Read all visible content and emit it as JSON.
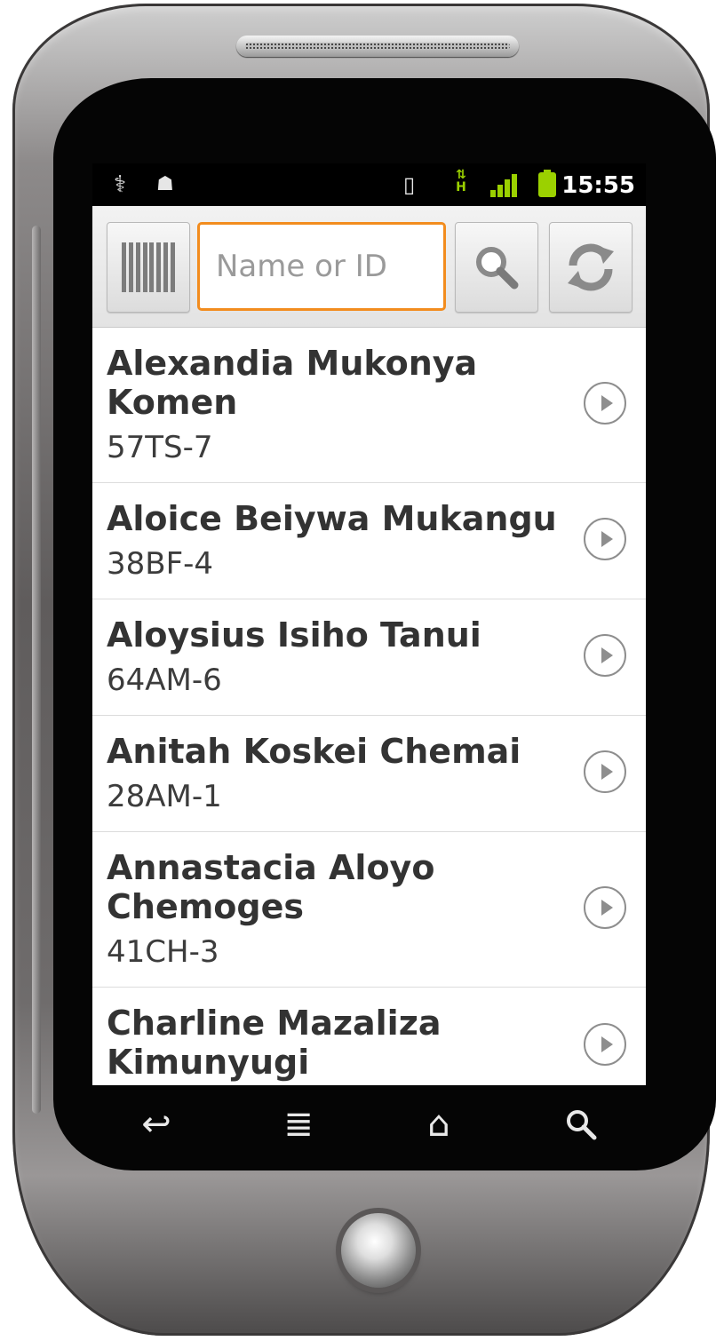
{
  "status_bar": {
    "time": "15:55",
    "icons": [
      "usb-icon",
      "android-debug-icon",
      "vibrate-icon",
      "hspa-icon",
      "signal-icon",
      "battery-icon"
    ],
    "network_label": "H"
  },
  "toolbar": {
    "search_placeholder": "Name or ID",
    "search_value": ""
  },
  "list": {
    "items": [
      {
        "name": "Alexandia Mukonya Komen",
        "id": "57TS-7"
      },
      {
        "name": "Aloice Beiywa Mukangu",
        "id": "38BF-4"
      },
      {
        "name": "Aloysius Isiho Tanui",
        "id": "64AM-6"
      },
      {
        "name": "Anitah Koskei Chemai",
        "id": "28AM-1"
      },
      {
        "name": "Annastacia Aloyo Chemoges",
        "id": "41CH-3"
      },
      {
        "name": "Charline Mazaliza Kimunyugi",
        "id": ""
      }
    ]
  },
  "softkeys": [
    "back-icon",
    "menu-icon",
    "home-icon",
    "search-icon"
  ],
  "colors": {
    "accent": "#f28c1e",
    "signal": "#9bd100",
    "text": "#333333"
  }
}
